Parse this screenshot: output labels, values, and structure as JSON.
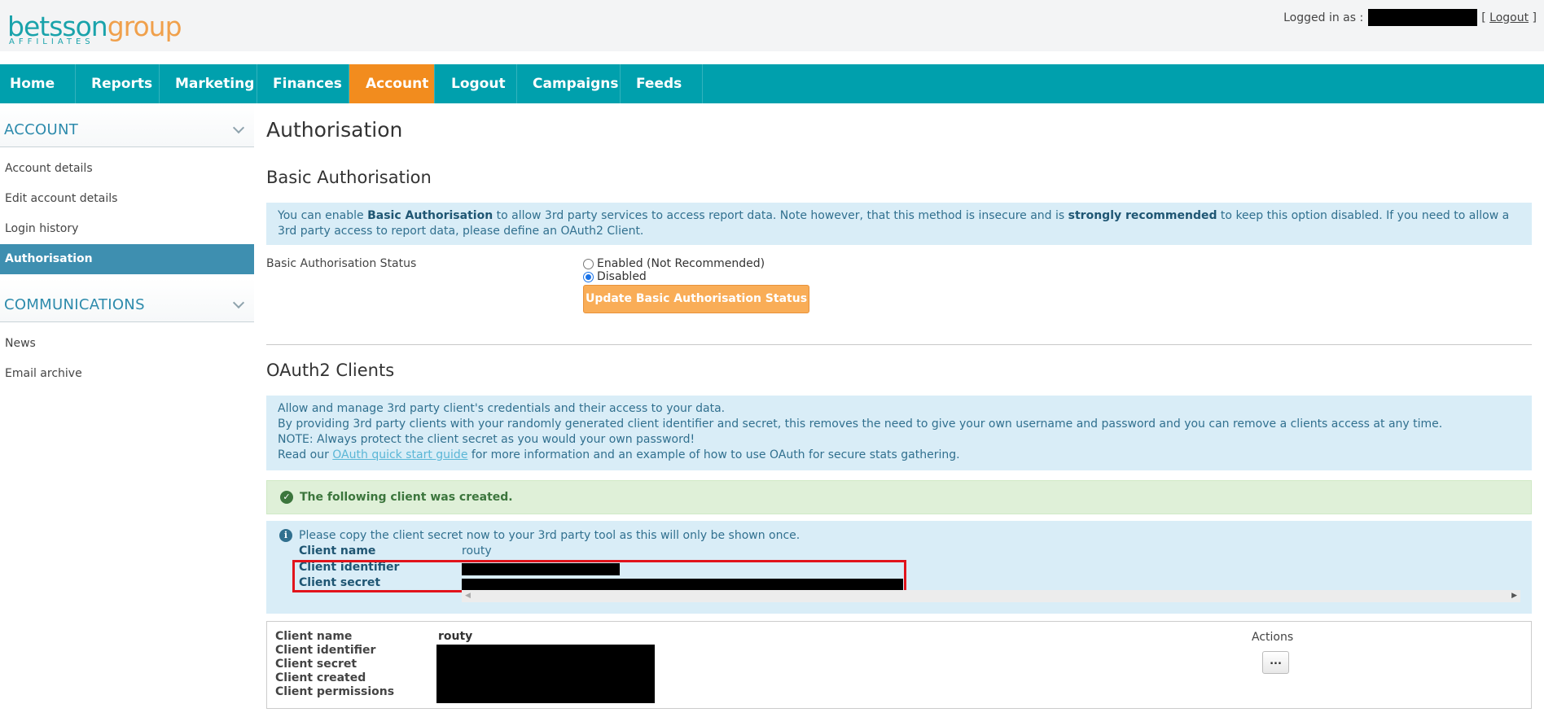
{
  "header": {
    "logo_word1": "betsson",
    "logo_word2": "group",
    "logo_sub": "AFFILIATES",
    "logged_in_label": "Logged in as :",
    "logout_link": "Logout"
  },
  "nav": {
    "items": [
      {
        "label": "Home"
      },
      {
        "label": "Reports"
      },
      {
        "label": "Marketing"
      },
      {
        "label": "Finances"
      },
      {
        "label": "Account"
      },
      {
        "label": "Logout"
      },
      {
        "label": "Campaigns"
      },
      {
        "label": "Feeds"
      }
    ],
    "active": "Account"
  },
  "sidebar": {
    "sections": [
      {
        "title": "ACCOUNT",
        "items": [
          "Account details",
          "Edit account details",
          "Login history",
          "Authorisation"
        ]
      },
      {
        "title": "COMMUNICATIONS",
        "items": [
          "News",
          "Email archive"
        ]
      }
    ],
    "active_item": "Authorisation"
  },
  "main": {
    "page_title": "Authorisation",
    "basic": {
      "heading": "Basic Authorisation",
      "info_p1": "You can enable ",
      "info_b1": "Basic Authorisation",
      "info_p2": " to allow 3rd party services to access report data. Note however, that this method is insecure and is ",
      "info_b2": "strongly recommended",
      "info_p3": " to keep this option disabled. If you need to allow a 3rd party access to report data, please define an OAuth2 Client.",
      "status_label": "Basic Authorisation Status",
      "option_enabled": "Enabled (Not Recommended)",
      "option_disabled": "Disabled",
      "selected": "Disabled",
      "update_button": "Update Basic Authorisation Status"
    },
    "oauth": {
      "heading": "OAuth2 Clients",
      "info_line1": "Allow and manage 3rd party client's credentials and their access to your data.",
      "info_line2": "By providing 3rd party clients with your randomly generated client identifier and secret, this removes the need to give your own username and password and you can remove a clients access at any time.",
      "info_line3": "NOTE: Always protect the client secret as you would your own password!",
      "info_line4_pre": "Read our ",
      "info_line4_link": "OAuth quick start guide",
      "info_line4_post": " for more information and an example of how to use OAuth for secure stats gathering.",
      "success_msg": "The following client was created.",
      "notice_msg": "Please copy the client secret now to your 3rd party tool as this will only be shown once.",
      "created": {
        "name_label": "Client name",
        "name_value": "routy",
        "id_label": "Client identifier",
        "secret_label": "Client secret"
      },
      "client_card": {
        "name_label": "Client name",
        "name_value": "routy",
        "id_label": "Client identifier",
        "secret_label": "Client secret",
        "created_label": "Client created",
        "permissions_label": "Client permissions",
        "actions_label": "Actions",
        "actions_button": "..."
      }
    }
  }
}
